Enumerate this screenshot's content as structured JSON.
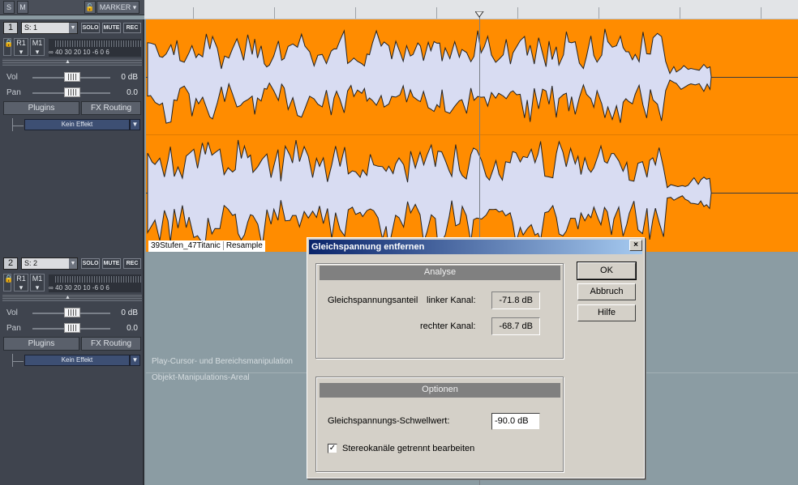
{
  "top": {
    "s_label": "S",
    "m_label": "M",
    "marker_label": "MARKER"
  },
  "tracks": [
    {
      "number": "1",
      "name": "S: 1",
      "solo": "SOLO",
      "mute": "MUTE",
      "rec": "REC",
      "r": "R1",
      "m": "M1",
      "meter_scale": "∞ 40 30 20 10 -6 0 6",
      "vol_label": "Vol",
      "vol_value": "0 dB",
      "pan_label": "Pan",
      "pan_value": "0.0",
      "plugins": "Plugins",
      "fx_routing": "FX Routing",
      "effect": "Kein Effekt"
    },
    {
      "number": "2",
      "name": "S: 2",
      "solo": "SOLO",
      "mute": "MUTE",
      "rec": "REC",
      "r": "R1",
      "m": "M1",
      "meter_scale": "∞ 40 30 20 10 -6 0 6",
      "vol_label": "Vol",
      "vol_value": "0 dB",
      "pan_label": "Pan",
      "pan_value": "0.0",
      "plugins": "Plugins",
      "fx_routing": "FX Routing",
      "effect": "Kein Effekt"
    }
  ],
  "clip": {
    "name": "39Stufen_47Titanic",
    "tag": "Resample"
  },
  "hints": [
    "Play-Cursor- und Bereichsmanipulation",
    "Objekt-Manipulations-Areal"
  ],
  "dialog": {
    "title": "Gleichspannung entfernen",
    "close": "×",
    "analysis": {
      "header": "Analyse",
      "label": "Gleichspannungsanteil",
      "left_label": "linker Kanal:",
      "left_value": "-71.8 dB",
      "right_label": "rechter Kanal:",
      "right_value": "-68.7 dB"
    },
    "options": {
      "header": "Optionen",
      "threshold_label": "Gleichspannungs-Schwellwert:",
      "threshold_value": "-90.0 dB",
      "stereo_label": "Stereokanäle getrennt bearbeiten",
      "stereo_checked": "✓"
    },
    "buttons": {
      "ok": "OK",
      "cancel": "Abbruch",
      "help": "Hilfe"
    }
  },
  "colors": {
    "track": "#ff8c00",
    "wave": "#d8dcf2",
    "dialog": "#d4d0c8"
  }
}
